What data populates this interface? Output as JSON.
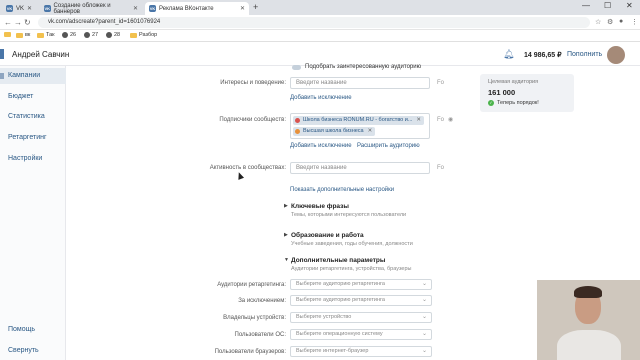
{
  "browser": {
    "tabs": [
      {
        "label": "VK",
        "active": false
      },
      {
        "label": "Создание обложек и баннеров",
        "active": false
      },
      {
        "label": "Реклама ВКонтакте",
        "active": true
      }
    ],
    "url": "vk.com/adscreate?parent_id=1601076924",
    "bookmarks": [
      "вк",
      "Так",
      "26",
      "27",
      "28",
      "Разбор"
    ]
  },
  "header": {
    "username": "Андрей Савчин",
    "balance": "14 986,65 ₽",
    "topup_label": "Пополнить"
  },
  "sidebar": {
    "items": [
      {
        "label": "Кампании"
      },
      {
        "label": "Бюджет"
      },
      {
        "label": "Статистика"
      },
      {
        "label": "Ретаргетинг"
      },
      {
        "label": "Настройки"
      }
    ],
    "help": "Помощь",
    "collapse": "Свернуть"
  },
  "form": {
    "similar_audience_label": "Подобрать заинтересованную аудиторию",
    "interests_label": "Интересы и поведение:",
    "interests_placeholder": "Введите название",
    "add_exclusion": "Добавить исключение",
    "subscribers_label": "Подписчики сообществ:",
    "tag1": "Школа бизнеса RONUM.RU - богатство и...",
    "tag2": "Высшая школа бизнеса",
    "add_exclusion2": "Добавить исключение",
    "expand_search": "Расширить аудиторию",
    "activity_label": "Активность в сообществах:",
    "activity_placeholder": "Введите название",
    "show_more": "Показать дополнительные настройки",
    "side_fo": "Fo"
  },
  "sections": [
    {
      "title": "Ключевые фразы",
      "subtitle": "Темы, которыми интересуются пользователи"
    },
    {
      "title": "Образование и работа",
      "subtitle": "Учебные заведения, годы обучения, должности"
    },
    {
      "title": "Дополнительные параметры",
      "subtitle": "Аудитории ретаргетинга, устройства, браузеры"
    }
  ],
  "extra": [
    {
      "label": "Аудитории ретаргетинга:",
      "placeholder": "Выберите аудиторию ретаргетинга"
    },
    {
      "label": "За исключением:",
      "placeholder": "Выберите аудиторию ретаргетинга"
    },
    {
      "label": "Владельцы устройств:",
      "placeholder": "Выберите устройство"
    },
    {
      "label": "Пользователи ОС:",
      "placeholder": "Выберите операционную систему"
    },
    {
      "label": "Пользователи браузеров:",
      "placeholder": "Выберите интернет-браузер"
    }
  ],
  "audience": {
    "label": "Целевая аудитория",
    "value": "161 000",
    "note": "Теперь порядок!"
  }
}
